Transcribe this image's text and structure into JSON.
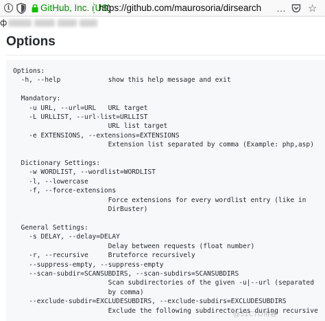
{
  "browser": {
    "site_identity": "GitHub, Inc. (US)",
    "url": "https://github.com/maurosoria/dirsearch",
    "more_icon": "…",
    "star_icon": "☆"
  },
  "blurred": {
    "leading_char": "ф"
  },
  "page": {
    "title": "Options"
  },
  "code": {
    "lines": [
      "Options:",
      "  -h, --help            show this help message and exit",
      "",
      "  Mandatory:",
      "    -u URL, --url=URL   URL target",
      "    -L URLLIST, --url-list=URLLIST",
      "                        URL list target",
      "    -e EXTENSIONS, --extensions=EXTENSIONS",
      "                        Extension list separated by comma (Example: php,asp)",
      "",
      "  Dictionary Settings:",
      "    -w WORDLIST, --wordlist=WORDLIST",
      "    -l, --lowercase",
      "    -f, --force-extensions",
      "                        Force extensions for every wordlist entry (like in",
      "                        DirBuster)",
      "",
      "  General Settings:",
      "    -s DELAY, --delay=DELAY",
      "                        Delay between requests (float number)",
      "    -r, --recursive     Bruteforce recursively",
      "    --suppress-empty, --suppress-empty",
      "    --scan-subdir=SCANSUBDIRS, --scan-subdirs=SCANSUBDIRS",
      "                        Scan subdirectories of the given -u|--url (separated",
      "                        by comma)",
      "    --exclude-subdir=EXCLUDESUBDIRS, --exclude-subdirs=EXCLUDESUBDIRS",
      "                        Exclude the following subdirectories during recursive"
    ]
  },
  "watermark": "@51CTO博客"
}
